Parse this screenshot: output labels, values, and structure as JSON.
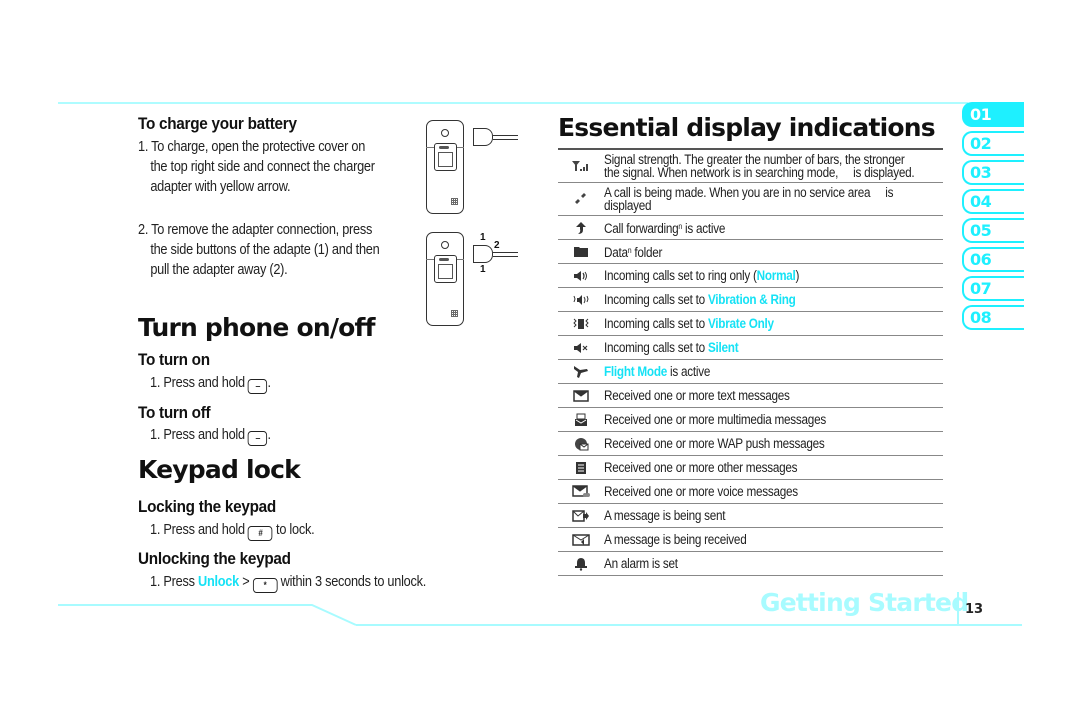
{
  "charge": {
    "heading": "To charge your battery",
    "step1_num": "1.",
    "step1_line1": "To charge, open the protective cover on",
    "step1_line2": "the top right side and connect the charger",
    "step1_line3": "adapter with yellow arrow.",
    "step2_num": "2.",
    "step2_line1": "To remove the adapter connection, press",
    "step2_line2": "the side buttons of the adapte (1) and then",
    "step2_line3": "pull the adapter away (2).",
    "callout_1": "1",
    "callout_2": "2"
  },
  "power": {
    "heading": "Turn phone on/off",
    "on_heading": "To turn on",
    "on_step": "1. Press and hold",
    "off_heading": "To turn off",
    "off_step": "1. Press and hold",
    "key_icon": "end-power-key-icon",
    "period": "."
  },
  "keypad": {
    "heading": "Keypad lock",
    "lock_heading": "Locking the keypad",
    "lock_step_pre": "1. Press and hold",
    "lock_key": "#",
    "lock_step_post": "to lock.",
    "unlock_heading": "Unlocking the keypad",
    "unlock_step_pre": "1. Press",
    "unlock_link": "Unlock",
    "unlock_sep": ">",
    "unlock_key": "*",
    "unlock_step_post": "within 3 seconds to unlock."
  },
  "indications": {
    "title": "Essential display indications",
    "rows": [
      {
        "icon": "signal-strength-icon",
        "line1": "Signal strength. The greater the number of bars, the stronger",
        "line2": "the signal. When network is in searching mode,     is displayed."
      },
      {
        "icon": "call-icon",
        "line1": "A call is being made. When you are in no service area     is",
        "line2": "displayed"
      },
      {
        "icon": "call-forwarding-icon",
        "pre": "Call forwarding",
        "sup": "n",
        "post": " is active"
      },
      {
        "icon": "folder-icon",
        "pre": "Data",
        "sup": "n",
        "post": " folder"
      },
      {
        "icon": "ring-icon",
        "pre": "Incoming calls set to ring only (",
        "hl": "Normal",
        "post": ")"
      },
      {
        "icon": "vibration-ring-icon",
        "pre": "Incoming calls set to ",
        "hl": "Vibration & Ring",
        "post": ""
      },
      {
        "icon": "vibrate-only-icon",
        "pre": "Incoming calls set to ",
        "hl": "Vibrate Only",
        "post": ""
      },
      {
        "icon": "silent-icon",
        "pre": "Incoming calls set to ",
        "hl": "Silent",
        "post": ""
      },
      {
        "icon": "flight-mode-icon",
        "pre": "",
        "hl": "Flight Mode",
        "post": " is active"
      },
      {
        "icon": "text-message-icon",
        "pre": "Received one or more text messages"
      },
      {
        "icon": "multimedia-message-icon",
        "pre": "Received one or more multimedia messages"
      },
      {
        "icon": "wap-push-icon",
        "pre": "Received one or more WAP push messages"
      },
      {
        "icon": "other-message-icon",
        "pre": "Received one or more other messages"
      },
      {
        "icon": "voice-message-icon",
        "pre": "Received one or more voice messages"
      },
      {
        "icon": "message-sending-icon",
        "pre": "A message is being sent"
      },
      {
        "icon": "message-receiving-icon",
        "pre": "A message is being received"
      },
      {
        "icon": "alarm-icon",
        "pre": "An alarm is set"
      }
    ]
  },
  "tabs": [
    "01",
    "02",
    "03",
    "04",
    "05",
    "06",
    "07",
    "08"
  ],
  "active_tab": "01",
  "footer": {
    "section": "Getting Started",
    "page": "13"
  },
  "colors": {
    "accent": "#1ef0ff",
    "accent_light": "#a8fbff"
  }
}
